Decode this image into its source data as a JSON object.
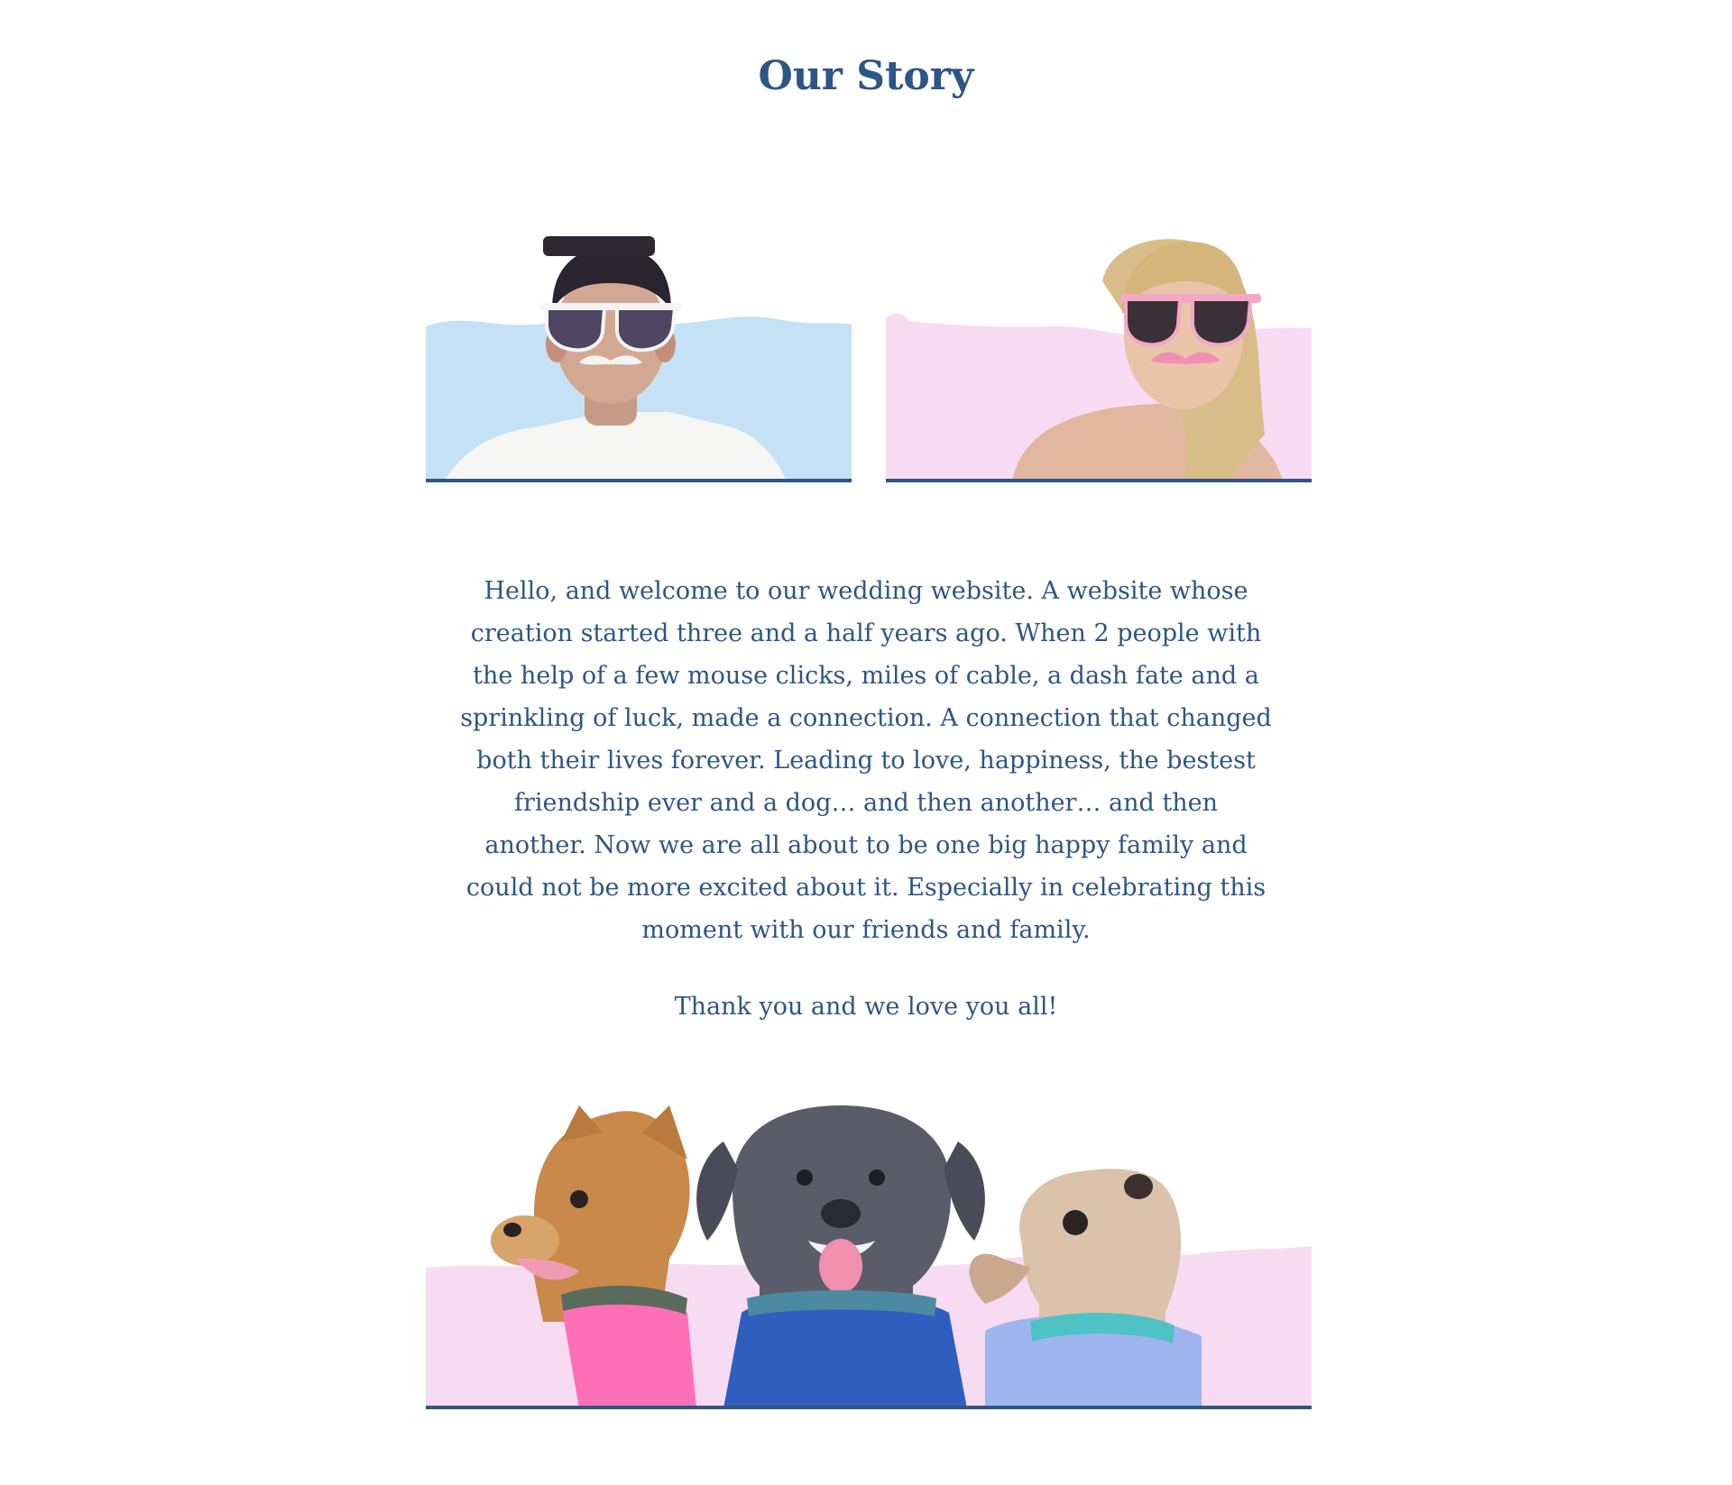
{
  "page": {
    "title": "Our Story"
  },
  "colors": {
    "text": "#2d5586",
    "blue_wash": "#c5e1f5",
    "pink_wash": "#f7dbf3",
    "baseline": "#2d5586"
  },
  "photos": {
    "groom": {
      "icon": "person-with-sunglasses-mustache-icon"
    },
    "bride": {
      "icon": "person-with-pink-sunglasses-mustache-icon"
    },
    "dogs": {
      "icon": "three-dogs-icon"
    }
  },
  "story": {
    "paragraph": "Hello, and welcome to our wedding website. A website whose creation started three and a half years ago. When 2 people with the help of a few mouse clicks, miles of cable, a dash fate and a sprinkling of luck, made a connection.  A connection that changed both their lives forever. Leading to love, happiness, the bestest friendship ever and a dog… and then another… and then another. Now we are all about to be one big happy family and could not be more excited about it. Especially in celebrating this moment with our friends and family.",
    "thanks": "Thank you and we love you all!"
  }
}
